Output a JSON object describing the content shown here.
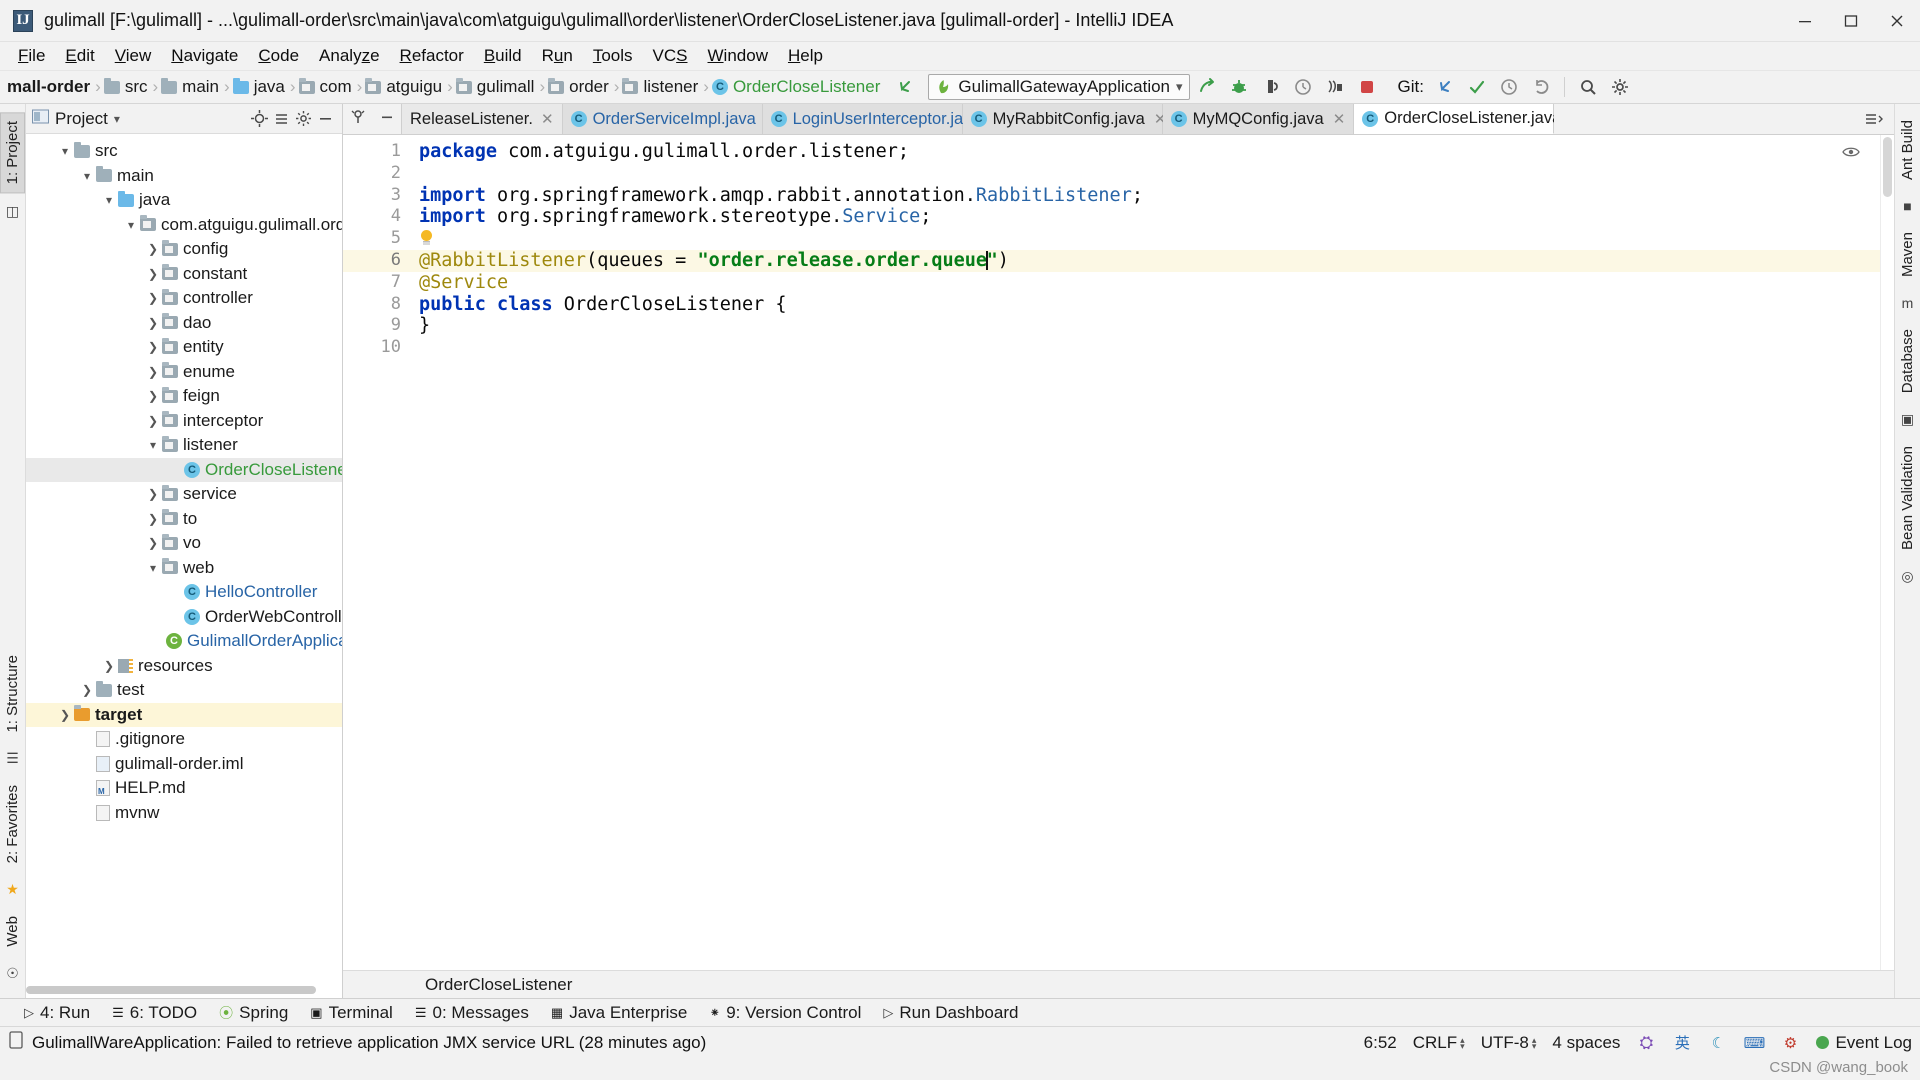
{
  "window": {
    "title": "gulimall [F:\\gulimall] - ...\\gulimall-order\\src\\main\\java\\com\\atguigu\\gulimall\\order\\listener\\OrderCloseListener.java [gulimall-order] - IntelliJ IDEA",
    "app_icon": "intellij-idea-icon",
    "minimize_label": "Minimize",
    "maximize_label": "Maximize",
    "close_label": "Close"
  },
  "menubar": {
    "items": [
      {
        "label": "File",
        "mnemonic": "F"
      },
      {
        "label": "Edit",
        "mnemonic": "E"
      },
      {
        "label": "View",
        "mnemonic": "V"
      },
      {
        "label": "Navigate",
        "mnemonic": "N"
      },
      {
        "label": "Code",
        "mnemonic": "C"
      },
      {
        "label": "Analyze",
        "mnemonic": "z"
      },
      {
        "label": "Refactor",
        "mnemonic": "R"
      },
      {
        "label": "Build",
        "mnemonic": "B"
      },
      {
        "label": "Run",
        "mnemonic": "u"
      },
      {
        "label": "Tools",
        "mnemonic": "T"
      },
      {
        "label": "VCS",
        "mnemonic": "S"
      },
      {
        "label": "Window",
        "mnemonic": "W"
      },
      {
        "label": "Help",
        "mnemonic": "H"
      }
    ]
  },
  "navbar": {
    "breadcrumbs": [
      {
        "label": "mall-order",
        "icon": "module-icon",
        "bold": true
      },
      {
        "label": "src",
        "icon": "folder-icon"
      },
      {
        "label": "main",
        "icon": "folder-icon"
      },
      {
        "label": "java",
        "icon": "source-folder-icon"
      },
      {
        "label": "com",
        "icon": "package-icon"
      },
      {
        "label": "atguigu",
        "icon": "package-icon"
      },
      {
        "label": "gulimall",
        "icon": "package-icon"
      },
      {
        "label": "order",
        "icon": "package-icon"
      },
      {
        "label": "listener",
        "icon": "package-icon"
      },
      {
        "label": "OrderCloseListener",
        "icon": "class-icon",
        "green": true
      }
    ],
    "separator": "›",
    "back_icon": "back-arrow-icon",
    "run_config": {
      "name": "GulimallGatewayApplication",
      "icon": "spring-boot-icon",
      "dropdown_icon": "chevron-down-icon"
    },
    "actions": [
      {
        "icon": "run-icon",
        "label": "Run"
      },
      {
        "icon": "debug-icon",
        "label": "Debug"
      },
      {
        "icon": "run-with-coverage-icon",
        "label": "Run with Coverage"
      },
      {
        "icon": "profile-icon",
        "label": "Profile"
      },
      {
        "icon": "attach-process-icon",
        "label": "Attach to Process"
      },
      {
        "icon": "stop-icon",
        "label": "Stop"
      }
    ],
    "git_label": "Git:",
    "git_actions": [
      {
        "icon": "update-project-icon",
        "label": "Update Project"
      },
      {
        "icon": "commit-icon",
        "label": "Commit"
      },
      {
        "icon": "history-icon",
        "label": "History"
      },
      {
        "icon": "rollback-icon",
        "label": "Rollback"
      }
    ],
    "right_actions": [
      {
        "icon": "search-everywhere-icon",
        "label": "Search Everywhere"
      },
      {
        "icon": "settings-icon",
        "label": "Settings"
      }
    ]
  },
  "left_strip": {
    "tabs": [
      {
        "label": "1: Project",
        "selected": true
      },
      {
        "label": "1: Structure",
        "selected": false
      },
      {
        "label": "2: Favorites",
        "selected": false
      },
      {
        "label": "Web",
        "selected": false
      }
    ]
  },
  "project_panel": {
    "title": "Project",
    "dropdown_icon": "chevron-down-icon",
    "toolbar_icons": [
      "locate-icon",
      "collapse-all-icon",
      "settings-icon",
      "hide-icon"
    ],
    "tree": [
      {
        "label": "src",
        "depth": 1,
        "icon": "folder-icon",
        "state": "expanded"
      },
      {
        "label": "main",
        "depth": 2,
        "icon": "folder-icon",
        "state": "expanded"
      },
      {
        "label": "java",
        "depth": 3,
        "icon": "source-folder-icon",
        "state": "expanded"
      },
      {
        "label": "com.atguigu.gulimall.order",
        "depth": 4,
        "icon": "package-icon",
        "state": "expanded"
      },
      {
        "label": "config",
        "depth": 5,
        "icon": "package-icon",
        "state": "collapsed"
      },
      {
        "label": "constant",
        "depth": 5,
        "icon": "package-icon",
        "state": "collapsed"
      },
      {
        "label": "controller",
        "depth": 5,
        "icon": "package-icon",
        "state": "collapsed"
      },
      {
        "label": "dao",
        "depth": 5,
        "icon": "package-icon",
        "state": "collapsed"
      },
      {
        "label": "entity",
        "depth": 5,
        "icon": "package-icon",
        "state": "collapsed"
      },
      {
        "label": "enume",
        "depth": 5,
        "icon": "package-icon",
        "state": "collapsed"
      },
      {
        "label": "feign",
        "depth": 5,
        "icon": "package-icon",
        "state": "collapsed"
      },
      {
        "label": "interceptor",
        "depth": 5,
        "icon": "package-icon",
        "state": "collapsed"
      },
      {
        "label": "listener",
        "depth": 5,
        "icon": "package-icon",
        "state": "expanded"
      },
      {
        "label": "OrderCloseListener",
        "depth": 6,
        "icon": "class-icon",
        "state": "leaf",
        "selected": true,
        "color": "green"
      },
      {
        "label": "service",
        "depth": 5,
        "icon": "package-icon",
        "state": "collapsed"
      },
      {
        "label": "to",
        "depth": 5,
        "icon": "package-icon",
        "state": "collapsed"
      },
      {
        "label": "vo",
        "depth": 5,
        "icon": "package-icon",
        "state": "collapsed"
      },
      {
        "label": "web",
        "depth": 5,
        "icon": "package-icon",
        "state": "expanded"
      },
      {
        "label": "HelloController",
        "depth": 6,
        "icon": "class-icon",
        "state": "leaf",
        "color": "blue"
      },
      {
        "label": "OrderWebController",
        "depth": 6,
        "icon": "class-icon",
        "state": "leaf"
      },
      {
        "label": "GulimallOrderApplication",
        "depth": 5,
        "icon": "spring-class-icon",
        "state": "leaf",
        "color": "blue"
      },
      {
        "label": "resources",
        "depth": 3,
        "icon": "resources-folder-icon",
        "state": "collapsed"
      },
      {
        "label": "test",
        "depth": 2,
        "icon": "folder-icon",
        "state": "collapsed"
      },
      {
        "label": "target",
        "depth": 1,
        "icon": "target-folder-icon",
        "state": "collapsed",
        "highlight": true
      },
      {
        "label": ".gitignore",
        "depth": 2,
        "icon": "file-icon",
        "state": "leaf"
      },
      {
        "label": "gulimall-order.iml",
        "depth": 2,
        "icon": "iml-file-icon",
        "state": "leaf"
      },
      {
        "label": "HELP.md",
        "depth": 2,
        "icon": "markdown-file-icon",
        "state": "leaf"
      },
      {
        "label": "mvnw",
        "depth": 2,
        "icon": "file-icon",
        "state": "leaf"
      }
    ]
  },
  "editor": {
    "gutter_icons": [
      "pin-icon",
      "minimize-icon"
    ],
    "tabs": [
      {
        "label": "ReleaseListener.java",
        "icon": "class-icon",
        "active": false,
        "truncated": true
      },
      {
        "label": "OrderServiceImpl.java",
        "icon": "class-icon",
        "active": false
      },
      {
        "label": "LoginUserInterceptor.java",
        "icon": "class-icon",
        "active": false
      },
      {
        "label": "MyRabbitConfig.java",
        "icon": "class-icon",
        "active": false
      },
      {
        "label": "MyMQConfig.java",
        "icon": "class-icon",
        "active": false
      },
      {
        "label": "OrderCloseListener.java",
        "icon": "class-icon",
        "active": true
      }
    ],
    "tab_close_icon": "close-icon",
    "tab_list_icon": "tab-list-icon",
    "preview_icon": "eye-icon",
    "line_numbers": [
      1,
      2,
      3,
      4,
      5,
      6,
      7,
      8,
      9,
      10
    ],
    "current_line": 6,
    "lines": [
      {
        "n": 1,
        "tokens": [
          {
            "t": "package",
            "c": "kw"
          },
          {
            "t": " com.atguigu.gulimall.order.listener;",
            "c": "plain"
          }
        ]
      },
      {
        "n": 2,
        "tokens": []
      },
      {
        "n": 3,
        "fold": true,
        "tokens": [
          {
            "t": "import",
            "c": "kw"
          },
          {
            "t": " org.springframework.amqp.rabbit.annotation.",
            "c": "plain"
          },
          {
            "t": "RabbitListener",
            "c": "cls"
          },
          {
            "t": ";",
            "c": "plain"
          }
        ]
      },
      {
        "n": 4,
        "fold": true,
        "tokens": [
          {
            "t": "import",
            "c": "kw"
          },
          {
            "t": " org.springframework.stereotype.",
            "c": "plain"
          },
          {
            "t": "Service",
            "c": "cls"
          },
          {
            "t": ";",
            "c": "plain"
          }
        ]
      },
      {
        "n": 5,
        "bulb": true,
        "tokens": []
      },
      {
        "n": 6,
        "fold": true,
        "current": true,
        "tokens": [
          {
            "t": "@RabbitListener",
            "c": "anno"
          },
          {
            "t": "(queues = ",
            "c": "plain"
          },
          {
            "t": "\"order.release.order.queue",
            "c": "str"
          },
          {
            "t": "CARET",
            "c": "caret"
          },
          {
            "t": "\"",
            "c": "str"
          },
          {
            "t": ")",
            "c": "plain"
          }
        ]
      },
      {
        "n": 7,
        "fold": true,
        "tokens": [
          {
            "t": "@Service",
            "c": "anno"
          }
        ]
      },
      {
        "n": 8,
        "tokens": [
          {
            "t": "public",
            "c": "kw"
          },
          {
            "t": " ",
            "c": "plain"
          },
          {
            "t": "class",
            "c": "kw"
          },
          {
            "t": " OrderCloseListener {",
            "c": "plain"
          }
        ]
      },
      {
        "n": 9,
        "tokens": [
          {
            "t": "}",
            "c": "plain"
          }
        ]
      },
      {
        "n": 10,
        "tokens": []
      }
    ],
    "footer_breadcrumb": "OrderCloseListener"
  },
  "right_strip": {
    "tabs": [
      {
        "label": "Ant Build"
      },
      {
        "label": "Maven"
      },
      {
        "label": "Database"
      },
      {
        "label": "Bean Validation"
      }
    ]
  },
  "tool_windows": [
    {
      "label": "4: Run",
      "mnemonic": "4",
      "icon": "run-icon"
    },
    {
      "label": "6: TODO",
      "mnemonic": "6",
      "icon": "list-icon"
    },
    {
      "label": "Spring",
      "icon": "spring-icon"
    },
    {
      "label": "Terminal",
      "icon": "terminal-icon"
    },
    {
      "label": "0: Messages",
      "mnemonic": "0",
      "icon": "messages-icon"
    },
    {
      "label": "Java Enterprise",
      "icon": "java-enterprise-icon"
    },
    {
      "label": "9: Version Control",
      "mnemonic": "9",
      "icon": "branch-icon"
    },
    {
      "label": "Run Dashboard",
      "icon": "run-dashboard-icon"
    }
  ],
  "statusbar": {
    "message_icon": "notification-icon",
    "message": "GulimallWareApplication: Failed to retrieve application JMX service URL (28 minutes ago)",
    "caret_position": "6:52",
    "line_separator": "CRLF",
    "encoding": "UTF-8",
    "indent": "4 spaces",
    "tray": [
      {
        "icon": "ime-logo-icon",
        "label": "Ⓤ"
      },
      {
        "icon": "ime-chinese-icon",
        "label": "英"
      },
      {
        "icon": "ime-moon-icon",
        "label": "☽"
      },
      {
        "icon": "ime-keyboard-icon",
        "label": "⌨"
      },
      {
        "icon": "ime-tools-icon",
        "label": "⚙"
      }
    ],
    "event_log": {
      "label": "Event Log",
      "icon": "event-log-icon"
    }
  },
  "watermark": "CSDN @wang_book",
  "colors": {
    "accent_green": "#389a3c",
    "keyword_blue": "#0033b3",
    "string_green": "#067d17",
    "annotation_gold": "#9e880d",
    "class_blue": "#2864a6",
    "current_line": "#fcf8e4",
    "selection": "#e9e9e9"
  }
}
